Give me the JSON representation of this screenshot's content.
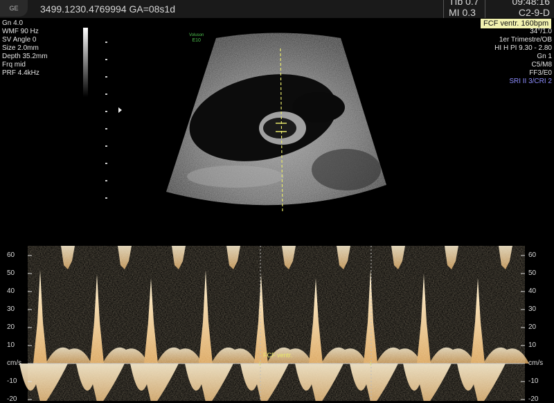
{
  "header": {
    "logo": "GE",
    "patient_line": "3499.1230.4769994  GA=08s1d",
    "tib": "TIb  0.7",
    "mi": "MI  0.3",
    "time": "09:48:16",
    "probe": "C2-9-D"
  },
  "left_params": [
    "Gn  4.0",
    "WMF 90 Hz",
    "SV Angle  0",
    "Size  2.0mm",
    "Depth 35.2mm",
    "Frq mid",
    "PRF  4.4kHz"
  ],
  "right_params": {
    "measurement": "FCF ventr. 160bpm",
    "lines": [
      "34°/1.0",
      "1er Trimestre/OB",
      "HI H PI 9.30 - 2.80",
      "Gn  1",
      "C5/M8",
      "FF3/E0"
    ],
    "sri": "SRI II 3/CRI 2"
  },
  "volume_badge": {
    "line1": "Voluson",
    "line2": "E10"
  },
  "doppler": {
    "unit": "cm/s",
    "scale_labels": [
      "60",
      "50",
      "40",
      "30",
      "20",
      "10",
      "cm/s",
      "-10",
      "-20"
    ],
    "scale_values": [
      60,
      50,
      40,
      30,
      20,
      10,
      0,
      -10,
      -20
    ],
    "beat_marker_label": "FCF ventr."
  },
  "colors": {
    "accent_yellow": "#f2f2b0",
    "caliper": "#e8e86a",
    "sri_blue": "#8e8eff",
    "doppler_signal": "#f5d9a0"
  }
}
